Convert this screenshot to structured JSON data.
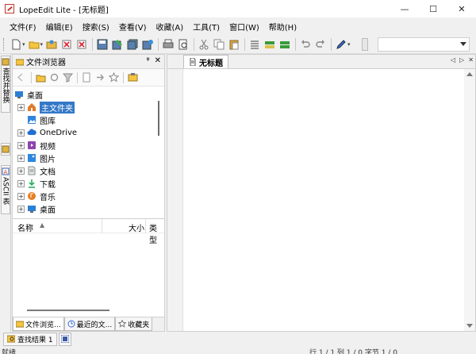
{
  "window": {
    "title": "LopeEdit Lite - [无标题]",
    "minimize": "—",
    "maximize": "☐",
    "close": "✕"
  },
  "menu": [
    "文件(F)",
    "编辑(E)",
    "搜索(S)",
    "查看(V)",
    "收藏(A)",
    "工具(T)",
    "窗口(W)",
    "帮助(H)"
  ],
  "left_tabs": {
    "find_replace": "查找并替换",
    "ascii": "ASCII 表"
  },
  "file_browser": {
    "title": "文件浏览器",
    "pin": "ᵠ",
    "close": "✕",
    "tree": [
      {
        "label": "桌面",
        "icon": "desktop-icon",
        "color": "#2b7fd4",
        "expand": false,
        "indent": 0
      },
      {
        "label": "主文件夹",
        "icon": "home-icon",
        "color": "#e07a2a",
        "expand": true,
        "indent": 1,
        "selected": true
      },
      {
        "label": "图库",
        "icon": "gallery-icon",
        "color": "#2e86de",
        "expand": false,
        "indent": 1
      },
      {
        "label": "OneDrive",
        "icon": "cloud-icon",
        "color": "#1f6fd1",
        "expand": true,
        "indent": 1
      },
      {
        "label": "视频",
        "icon": "video-icon",
        "color": "#8e44ad",
        "expand": true,
        "indent": 1
      },
      {
        "label": "图片",
        "icon": "picture-icon",
        "color": "#2e86de",
        "expand": true,
        "indent": 1
      },
      {
        "label": "文档",
        "icon": "document-icon",
        "color": "#7f8c8d",
        "expand": true,
        "indent": 1
      },
      {
        "label": "下载",
        "icon": "download-icon",
        "color": "#27ae60",
        "expand": true,
        "indent": 1
      },
      {
        "label": "音乐",
        "icon": "music-icon",
        "color": "#e67e22",
        "expand": true,
        "indent": 1
      },
      {
        "label": "桌面",
        "icon": "desktop-icon",
        "color": "#2b7fd4",
        "expand": true,
        "indent": 1
      }
    ],
    "columns": {
      "name": "名称",
      "size": "大小",
      "type": "类型"
    },
    "bottom_tabs": [
      "文件浏览...",
      "最近的文...",
      "收藏夹"
    ]
  },
  "editor": {
    "tab_title": "无标题",
    "nav_prev": "◁",
    "nav_next": "▷",
    "nav_close": "✕"
  },
  "find_results": {
    "label": "查找结果 1"
  },
  "status": {
    "left": "就绪",
    "right": "行 1 / 1  列 1 / 0  字节 1 / 0"
  }
}
